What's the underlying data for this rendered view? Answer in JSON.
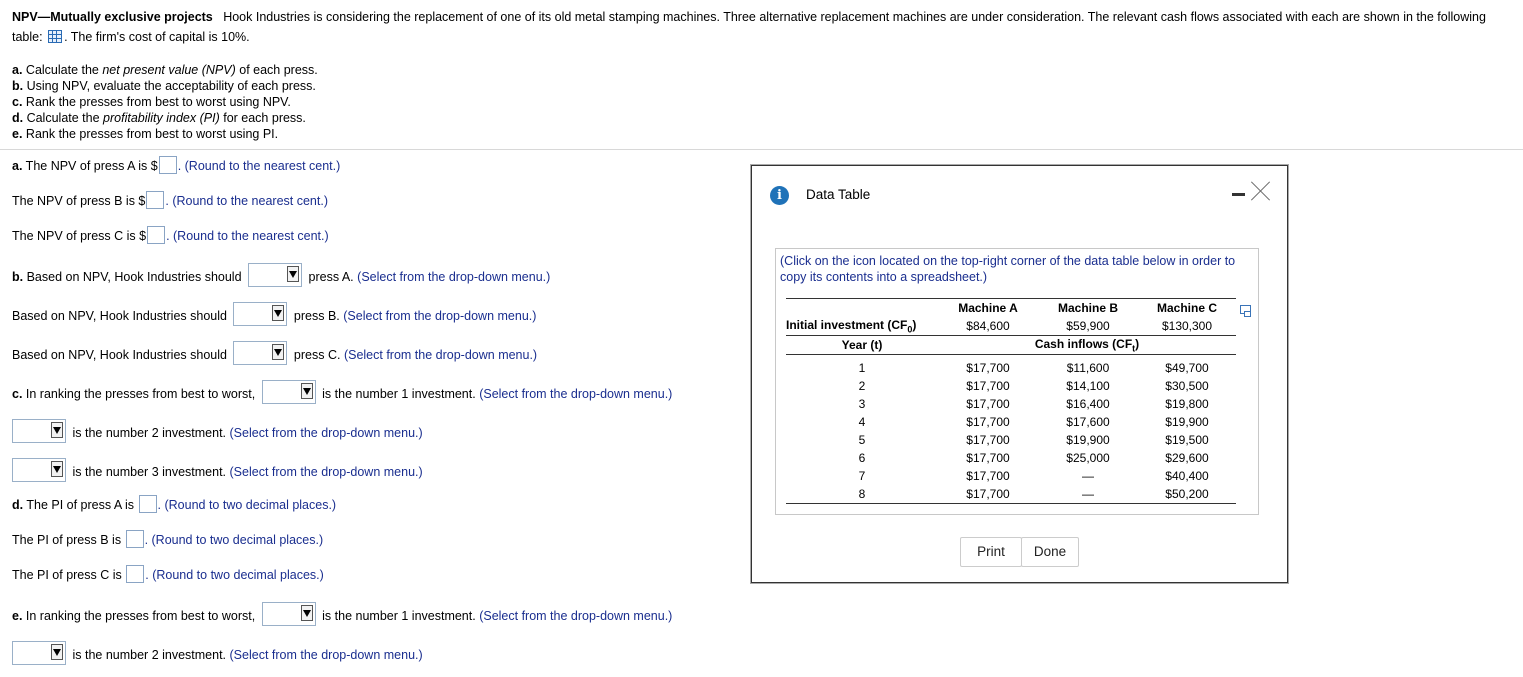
{
  "header": {
    "title": "NPV—Mutually exclusive projects",
    "text1": "Hook Industries is considering the replacement of one of its old metal stamping machines. Three alternative replacement machines are under consideration. The relevant cash flows associated with each are shown in the following table:",
    "text2": ". The firm's cost of capital is 10%."
  },
  "questions": [
    "a. Calculate the net present value (NPV) of each press.",
    "b. Using NPV, evaluate the acceptability of each press.",
    "c. Rank the presses from best to worst using NPV.",
    "d. Calculate the profitability index (PI) for each press.",
    "e. Rank the presses from best to worst using PI."
  ],
  "answers": {
    "npv_a_pre": "a. The NPV of press A is $",
    "npv_b_pre": "The NPV of press B is $",
    "npv_c_pre": "The NPV of press C is $",
    "round_cent": ". (Round to the nearest cent.)",
    "b_pre": "b. Based on NPV, Hook Industries should",
    "b2_pre": "Based on NPV, Hook Industries should",
    "press_a": "press A.",
    "press_b": "press B.",
    "press_c": "press C.",
    "select_hint": "(Select from the drop-down menu.)",
    "c_pre": "c.  In ranking the presses from best to worst,",
    "e_pre": "e. In ranking the presses from best to worst,",
    "num1": "is the number 1 investment.",
    "num2": "is the number 2 investment.",
    "num3": "is the number 3 investment.",
    "pi_a_pre": "d. The PI of press A is",
    "pi_b_pre": "The PI of press B is",
    "pi_c_pre": "The PI of press C is",
    "round_two": ". (Round to two decimal places.)"
  },
  "dialog": {
    "title": "Data Table",
    "note": "(Click on the icon located on the top-right corner of the data table below in order to copy its contents into a spreadsheet.)",
    "print": "Print",
    "done": "Done",
    "machines": [
      "Machine A",
      "Machine B",
      "Machine C"
    ],
    "initial_label": "Initial investment (CF",
    "initial_sub": "0",
    "initial": [
      "$84,600",
      "$59,900",
      "$130,300"
    ],
    "year_label": "Year (t)",
    "cash_label": "Cash inflows (CF",
    "cash_sub": "t",
    "rows": [
      {
        "t": "1",
        "a": "$17,700",
        "b": "$11,600",
        "c": "$49,700"
      },
      {
        "t": "2",
        "a": "$17,700",
        "b": "$14,100",
        "c": "$30,500"
      },
      {
        "t": "3",
        "a": "$17,700",
        "b": "$16,400",
        "c": "$19,800"
      },
      {
        "t": "4",
        "a": "$17,700",
        "b": "$17,600",
        "c": "$19,900"
      },
      {
        "t": "5",
        "a": "$17,700",
        "b": "$19,900",
        "c": "$19,500"
      },
      {
        "t": "6",
        "a": "$17,700",
        "b": "$25,000",
        "c": "$29,600"
      },
      {
        "t": "7",
        "a": "$17,700",
        "b": "—",
        "c": "$40,400"
      },
      {
        "t": "8",
        "a": "$17,700",
        "b": "—",
        "c": "$50,200"
      }
    ]
  }
}
